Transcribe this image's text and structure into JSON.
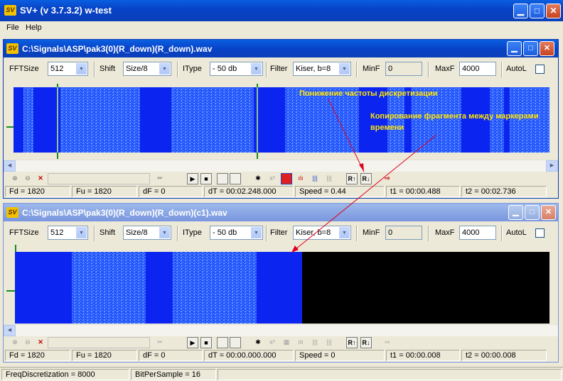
{
  "app": {
    "title": "SV+  (v 3.7.3.2) w-test",
    "logo_text": "SV",
    "min_glyph": "▁",
    "max_glyph": "□",
    "close_glyph": "✕"
  },
  "menu": [
    "File",
    "Help"
  ],
  "windows": [
    {
      "title": "C:\\Signals\\ASP\\pak3(0)(R_down)(R_down).wav",
      "controls": {
        "fftsize_label": "FFTSize",
        "fftsize_value": "512",
        "shift_label": "Shift",
        "shift_value": "Size/8",
        "itype_label": "IType",
        "itype_value": "- 50 db",
        "filter_label": "Filter",
        "filter_value": "Kiser, b=8",
        "minf_label": "MinF",
        "minf_value": "0",
        "maxf_label": "MaxF",
        "maxf_value": "4000",
        "autol_label": "AutoL"
      },
      "annotations": [
        "Понижение частоты дискретизации",
        "Копирование фрагмента между маркерами времени"
      ],
      "status": {
        "fd": "Fd = 1820",
        "fu": "Fu = 1820",
        "df": "dF = 0",
        "dt": "dT = 00:02.248.000",
        "speed": "Speed = 0.44",
        "t1": "t1 = 00:00.488",
        "t2": "t2 = 00:02.736"
      }
    },
    {
      "title": "C:\\Signals\\ASP\\pak3(0)(R_down)(R_down)(c1).wav",
      "controls": {
        "fftsize_label": "FFTSize",
        "fftsize_value": "512",
        "shift_label": "Shift",
        "shift_value": "Size/8",
        "itype_label": "IType",
        "itype_value": "- 50 db",
        "filter_label": "Filter",
        "filter_value": "Kiser, b=8",
        "minf_label": "MinF",
        "minf_value": "0",
        "maxf_label": "MaxF",
        "maxf_value": "4000",
        "autol_label": "AutoL"
      },
      "status": {
        "fd": "Fd = 1820",
        "fu": "Fu = 1820",
        "df": "dF = 0",
        "dt": "dT = 00:00.000.000",
        "speed": "Speed = 0",
        "t1": "t1 = 00:00.008",
        "t2": "t2 = 00:00.008"
      }
    }
  ],
  "toolbar_icons": {
    "zoom_in": "⊕",
    "zoom_out": "⊖",
    "no": "✕",
    "cut": "✂",
    "play": "▶",
    "stop": "■",
    "star": "✱",
    "xsq": "x²",
    "rup": "R↑",
    "rdown": "R↓",
    "save": "⇨"
  },
  "bottom_status": {
    "freq": "FreqDiscretization = 8000",
    "bits": "BitPerSample = 16"
  },
  "colors": {
    "titlebar": "#0a4fd8",
    "spectrum_bg": "#0b24f0",
    "annotation": "#ffe600",
    "arrow": "#e0001e",
    "marker": "#1a8a1a"
  }
}
